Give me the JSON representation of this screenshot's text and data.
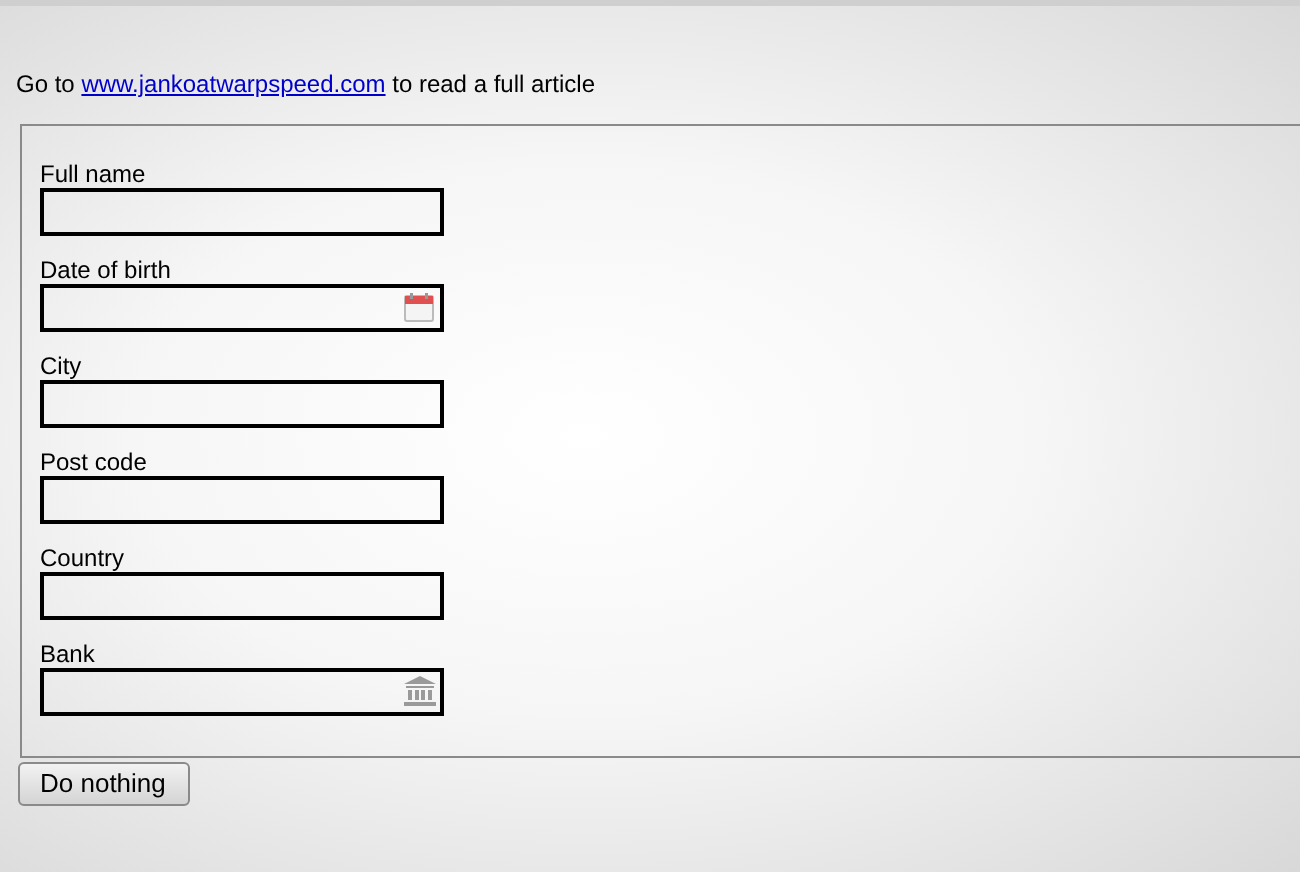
{
  "intro": {
    "before": "Go to",
    "link": "www.jankoatwarpspeed.com",
    "after": "to read a full article"
  },
  "fields": [
    {
      "label": "Full name",
      "kind": "text"
    },
    {
      "label": "Date of birth",
      "kind": "date"
    },
    {
      "label": "City",
      "kind": "text"
    },
    {
      "label": "Post code",
      "kind": "text"
    },
    {
      "label": "Country",
      "kind": "text"
    },
    {
      "label": "Bank",
      "kind": "bank"
    }
  ],
  "button": "Do nothing"
}
